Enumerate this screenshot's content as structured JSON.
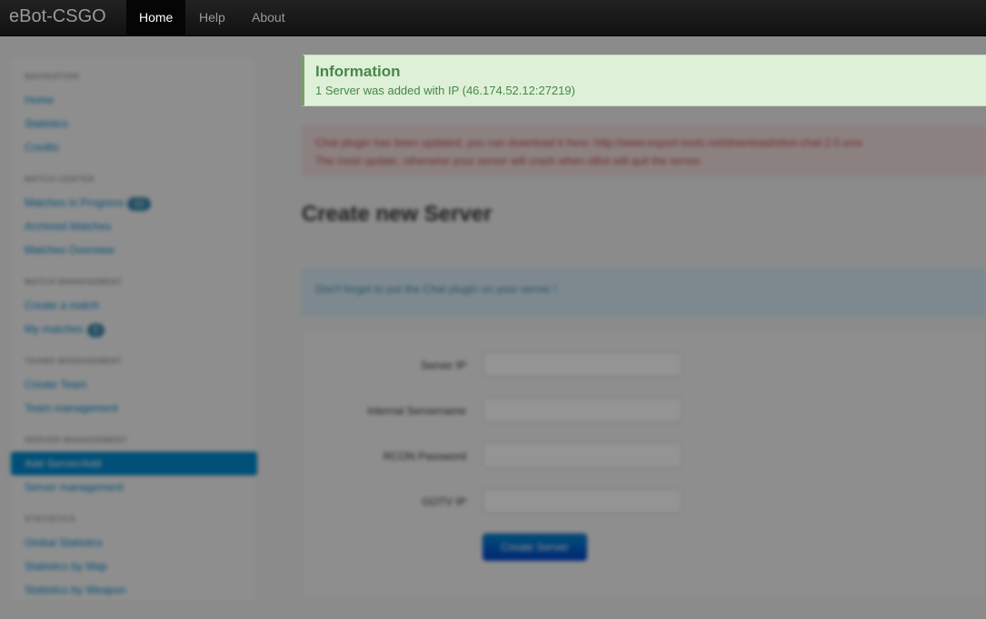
{
  "navbar": {
    "brand": "eBot-CSGO",
    "items": [
      {
        "label": "Home",
        "active": true
      },
      {
        "label": "Help",
        "active": false
      },
      {
        "label": "About",
        "active": false
      }
    ]
  },
  "notification": {
    "title": "Information",
    "message": "1 Server was added with IP (46.174.52.12:27219)"
  },
  "sidebar": {
    "sections": [
      {
        "header": "Navigation",
        "items": [
          {
            "label": "Home"
          },
          {
            "label": "Statistics"
          },
          {
            "label": "Credits"
          }
        ]
      },
      {
        "header": "Match Center",
        "items": [
          {
            "label": "Matches in Progress",
            "badge": "12"
          },
          {
            "label": "Archived Matches"
          },
          {
            "label": "Matches Overview"
          }
        ]
      },
      {
        "header": "Match Management",
        "items": [
          {
            "label": "Create a match"
          },
          {
            "label": "My matches",
            "badge": "0"
          }
        ]
      },
      {
        "header": "Teams Management",
        "items": [
          {
            "label": "Create Team"
          },
          {
            "label": "Team management"
          }
        ]
      },
      {
        "header": "Server Management",
        "items": [
          {
            "label": "Add Server/Add",
            "active": true
          },
          {
            "label": "Server management"
          }
        ]
      },
      {
        "header": "Statistics",
        "items": [
          {
            "label": "Global Statistics"
          },
          {
            "label": "Statistics by Map"
          },
          {
            "label": "Statistics by Weapon"
          }
        ]
      }
    ]
  },
  "main": {
    "warning_text": "Chat plugin has been updated, you can download it here: http://www.esport-tools.net/download/ebot-chat-2.0.smx",
    "warning_text2": "The most update, otherwise your server will crash when eBot will quit the server.",
    "heading": "Create new Server",
    "info_text": "Don't forget to put the Chat plugin on your server !",
    "form": {
      "fields": [
        {
          "label": "Server IP"
        },
        {
          "label": "Internal Servername"
        },
        {
          "label": "RCON Password"
        },
        {
          "label": "GOTV IP"
        }
      ],
      "submit_label": "Create Server"
    }
  }
}
